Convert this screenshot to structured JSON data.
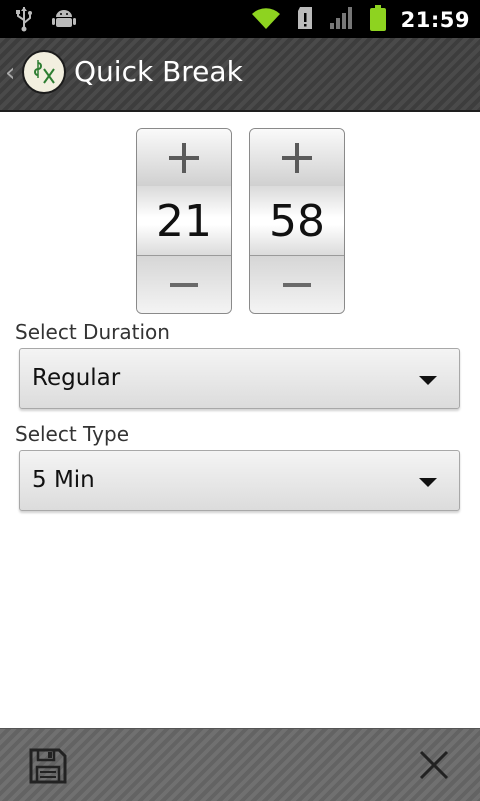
{
  "status_bar": {
    "time": "21:59"
  },
  "app_bar": {
    "title": "Quick Break"
  },
  "time_picker": {
    "hour": "21",
    "minute": "58",
    "increment_symbol": "+",
    "decrement_symbol": "−"
  },
  "form": {
    "duration": {
      "label": "Select Duration",
      "value": "Regular"
    },
    "type": {
      "label": "Select Type",
      "value": "5 Min"
    }
  },
  "icons": {
    "usb": "usb-icon",
    "android": "android-debug-icon",
    "wifi": "wifi-icon",
    "sd_alert": "sd-card-alert-icon",
    "signal": "signal-icon",
    "battery": "battery-icon",
    "save": "save-icon",
    "close": "close-icon"
  },
  "colors": {
    "wifi": "#8ed320",
    "battery": "#8ed320",
    "appbar": "#444444",
    "bottombar": "#6a6a6a"
  }
}
